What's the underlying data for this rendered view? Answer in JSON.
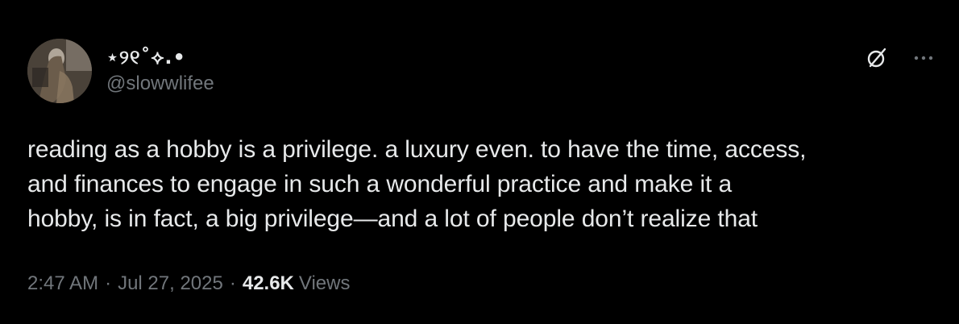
{
  "tweet": {
    "author": {
      "display_name": "⋆୨୧˚⟡.•",
      "handle": "@slowwlifee",
      "avatar_icon": "profile-photo"
    },
    "actions": {
      "grok_icon": "grok-icon",
      "more_icon": "more-options-icon"
    },
    "text": "reading as a hobby is a privilege. a luxury even. to have the time, access,\nand finances to engage in such a wonderful practice and make it a\nhobby, is in fact, a big privilege—and a lot of people don’t realize that",
    "meta": {
      "time": "2:47 AM",
      "separator": "·",
      "date": "Jul 27, 2025",
      "views_count": "42.6K",
      "views_label": "Views"
    }
  },
  "colors": {
    "background": "#000000",
    "primary_text": "#e7e9ea",
    "secondary_text": "#71767b"
  }
}
